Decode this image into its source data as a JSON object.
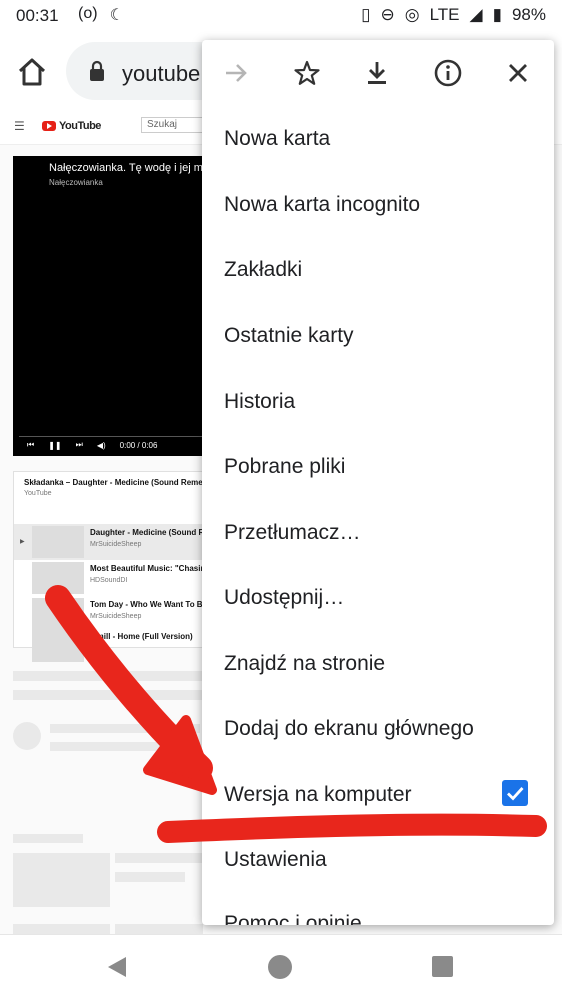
{
  "status_bar": {
    "time": "00:31",
    "network": "LTE",
    "battery": "98%"
  },
  "toolbar": {
    "url": "youtube"
  },
  "youtube": {
    "logo": "YouTube",
    "search_placeholder": "Szukaj",
    "video_title": "Nałęczowianka. Tę wodę i jej min",
    "video_channel": "Nałęczowianka",
    "video_time": "0:00 / 0:06",
    "playlist_title": "Składanka – Daughter - Medicine (Sound Remedy",
    "playlist_source": "YouTube",
    "playlist_items": [
      {
        "title": "Daughter - Medicine (Sound Re",
        "channel": "MrSuicideSheep"
      },
      {
        "title": "Most Beautiful Music: \"Chasing",
        "channel": "HDSoundDI"
      },
      {
        "title": "Tom Day - Who We Want To Be",
        "channel": "MrSuicideSheep"
      },
      {
        "title": "...mill - Home (Full Version)",
        "channel": ""
      }
    ]
  },
  "menu": {
    "icons": [
      "forward-icon",
      "star-icon",
      "download-icon",
      "info-icon",
      "close-icon"
    ],
    "items": [
      "Nowa karta",
      "Nowa karta incognito",
      "Zakładki",
      "Ostatnie karty",
      "Historia",
      "Pobrane pliki",
      "Przetłumacz…",
      "Udostępnij…",
      "Znajdź na stronie",
      "Dodaj do ekranu głównego",
      "Wersja na komputer",
      "Ustawienia",
      "Pomoc i opinie"
    ],
    "desktop_site_checked": true
  },
  "annotation_colors": {
    "arrow": "#e8261c"
  }
}
